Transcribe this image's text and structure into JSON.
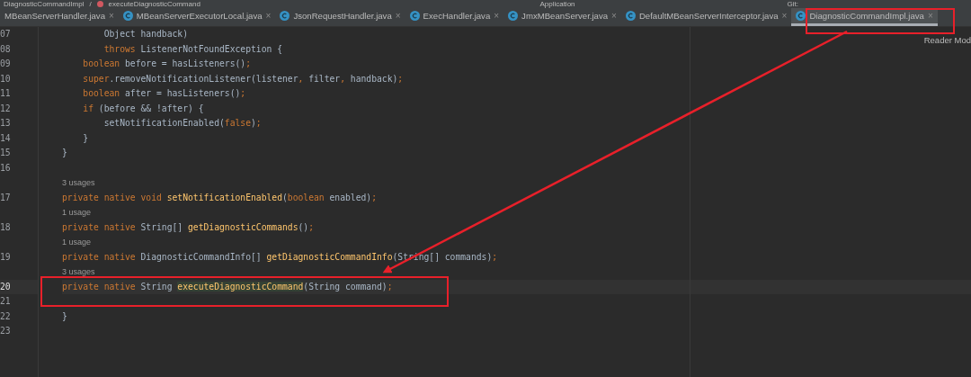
{
  "top_strip": {
    "breadcrumbs": [
      "DiagnosticCommandImpl",
      "executeDiagnosticCommand"
    ],
    "separator": "/",
    "run_config": "Application",
    "vcs": "Git:"
  },
  "tabs": [
    {
      "label": "MBeanServerHandler.java",
      "selected": false,
      "icon": false,
      "close": "×"
    },
    {
      "label": "MBeanServerExecutorLocal.java",
      "selected": false,
      "icon": true,
      "close": "×"
    },
    {
      "label": "JsonRequestHandler.java",
      "selected": false,
      "icon": true,
      "close": "×"
    },
    {
      "label": "ExecHandler.java",
      "selected": false,
      "icon": true,
      "close": "×"
    },
    {
      "label": "JmxMBeanServer.java",
      "selected": false,
      "icon": true,
      "close": "×"
    },
    {
      "label": "DefaultMBeanServerInterceptor.java",
      "selected": false,
      "icon": true,
      "close": "×"
    },
    {
      "label": "DiagnosticCommandImpl.java",
      "selected": true,
      "icon": true,
      "close": "×"
    }
  ],
  "reader_mode": "Reader Mod",
  "lines": [
    {
      "kind": "code",
      "number": "07",
      "current": false,
      "tokens": [
        {
          "text": "        Object handback)",
          "kind": "plain"
        }
      ]
    },
    {
      "kind": "code",
      "number": "08",
      "current": false,
      "tokens": [
        {
          "text": "        throws",
          "kind": "keyword"
        },
        {
          "text": " ListenerNotFoundException {",
          "kind": "plain"
        }
      ]
    },
    {
      "kind": "code",
      "number": "09",
      "current": false,
      "tokens": [
        {
          "text": "    boolean",
          "kind": "keyword"
        },
        {
          "text": " before = hasListeners()",
          "kind": "plain"
        },
        {
          "text": ";",
          "kind": "keyword"
        }
      ]
    },
    {
      "kind": "code",
      "number": "10",
      "current": false,
      "tokens": [
        {
          "text": "    super",
          "kind": "keyword"
        },
        {
          "text": ".removeNotificationListener(listener",
          "kind": "plain"
        },
        {
          "text": ",",
          "kind": "keyword"
        },
        {
          "text": " filter",
          "kind": "plain"
        },
        {
          "text": ",",
          "kind": "keyword"
        },
        {
          "text": " handback)",
          "kind": "plain"
        },
        {
          "text": ";",
          "kind": "keyword"
        }
      ]
    },
    {
      "kind": "code",
      "number": "11",
      "current": false,
      "tokens": [
        {
          "text": "    boolean",
          "kind": "keyword"
        },
        {
          "text": " after = hasListeners()",
          "kind": "plain"
        },
        {
          "text": ";",
          "kind": "keyword"
        }
      ]
    },
    {
      "kind": "code",
      "number": "12",
      "current": false,
      "tokens": [
        {
          "text": "    if",
          "kind": "keyword"
        },
        {
          "text": " (before && !after) {",
          "kind": "plain"
        }
      ]
    },
    {
      "kind": "code",
      "number": "13",
      "current": false,
      "tokens": [
        {
          "text": "        setNotificationEnabled(",
          "kind": "plain"
        },
        {
          "text": "false",
          "kind": "keyword"
        },
        {
          "text": ")",
          "kind": "plain"
        },
        {
          "text": ";",
          "kind": "keyword"
        }
      ]
    },
    {
      "kind": "code",
      "number": "14",
      "current": false,
      "tokens": [
        {
          "text": "    }",
          "kind": "plain"
        }
      ]
    },
    {
      "kind": "code",
      "number": "15",
      "current": false,
      "tokens": [
        {
          "text": "}",
          "kind": "plain"
        }
      ]
    },
    {
      "kind": "code",
      "number": "16",
      "current": false
    },
    {
      "kind": "usage",
      "text": "3 usages"
    },
    {
      "kind": "code",
      "number": "17",
      "current": false,
      "tokens": [
        {
          "text": "private native void ",
          "kind": "keyword"
        },
        {
          "text": "setNotificationEnabled",
          "kind": "declaration"
        },
        {
          "text": "(",
          "kind": "plain"
        },
        {
          "text": "boolean",
          "kind": "keyword"
        },
        {
          "text": " enabled)",
          "kind": "plain"
        },
        {
          "text": ";",
          "kind": "keyword"
        }
      ]
    },
    {
      "kind": "usage",
      "text": "1 usage"
    },
    {
      "kind": "code",
      "number": "18",
      "current": false,
      "tokens": [
        {
          "text": "private native ",
          "kind": "keyword"
        },
        {
          "text": "String[] ",
          "kind": "plain"
        },
        {
          "text": "getDiagnosticCommands",
          "kind": "declaration"
        },
        {
          "text": "()",
          "kind": "plain"
        },
        {
          "text": ";",
          "kind": "keyword"
        }
      ]
    },
    {
      "kind": "usage",
      "text": "1 usage"
    },
    {
      "kind": "code",
      "number": "19",
      "current": false,
      "tokens": [
        {
          "text": "private native ",
          "kind": "keyword"
        },
        {
          "text": "DiagnosticCommandInfo[] ",
          "kind": "plain"
        },
        {
          "text": "getDiagnosticCommandInfo",
          "kind": "declaration"
        },
        {
          "text": "(String[] commands)",
          "kind": "plain"
        },
        {
          "text": ";",
          "kind": "keyword"
        }
      ]
    },
    {
      "kind": "usage",
      "text": "3 usages"
    },
    {
      "kind": "code",
      "number": "20",
      "current": true,
      "tokens": [
        {
          "text": "private native ",
          "kind": "keyword"
        },
        {
          "text": "String ",
          "kind": "plain"
        },
        {
          "text": "executeDiagnosticCommand",
          "kind": "match"
        },
        {
          "text": "(String command)",
          "kind": "plain"
        },
        {
          "text": ";",
          "kind": "keyword"
        }
      ]
    },
    {
      "kind": "code",
      "number": "21",
      "current": false
    },
    {
      "kind": "code",
      "number": "22",
      "current": false,
      "tokens": [
        {
          "text": "}",
          "kind": "plain"
        }
      ]
    },
    {
      "kind": "code",
      "number": "23",
      "current": false
    }
  ]
}
